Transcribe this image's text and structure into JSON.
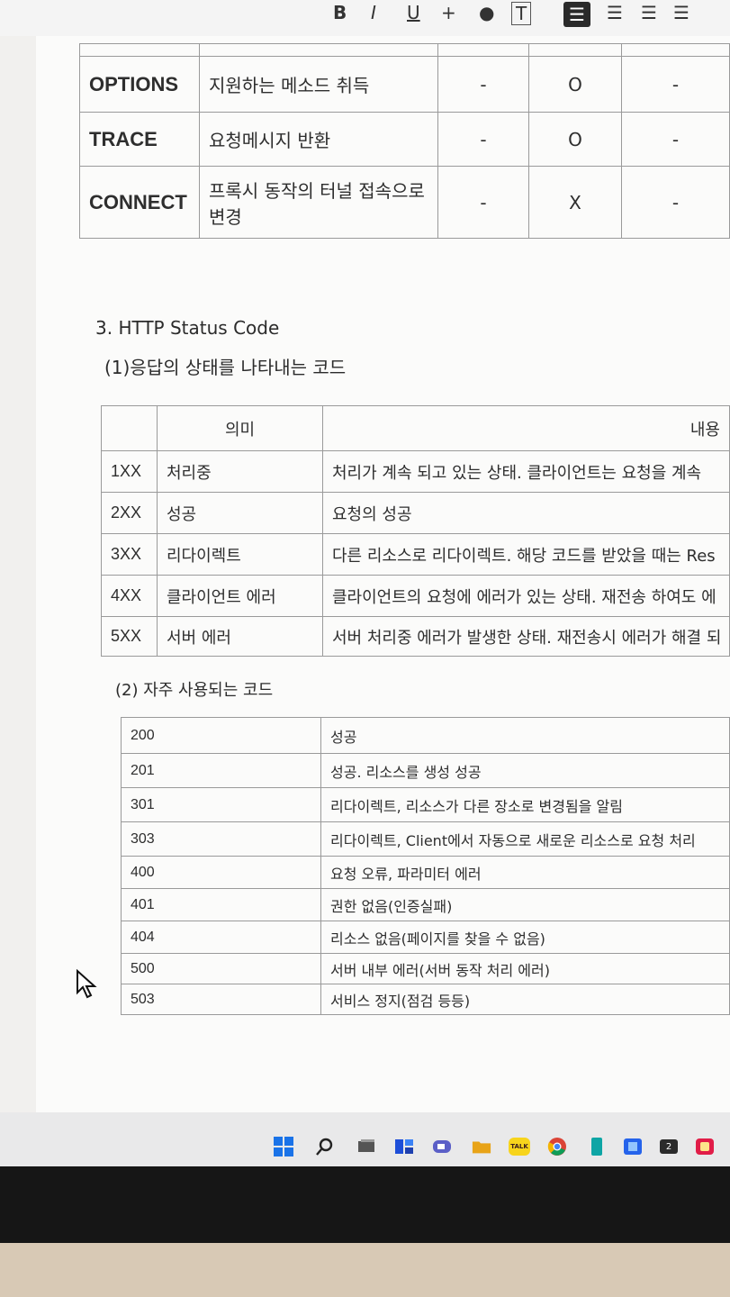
{
  "toolbar": {
    "buttons": [
      {
        "label": "B",
        "name": "bold"
      },
      {
        "label": "I",
        "name": "italic"
      },
      {
        "label": "U",
        "name": "underline"
      },
      {
        "label": "+",
        "name": "strikethrough"
      },
      {
        "label": "T",
        "name": "text-box"
      }
    ]
  },
  "methods_table": {
    "rows": [
      {
        "method": "OPTIONS",
        "desc": "지원하는 메소드 취득",
        "c1": "-",
        "c2": "O",
        "c3": "-"
      },
      {
        "method": "TRACE",
        "desc": "요청메시지 반환",
        "c1": "-",
        "c2": "O",
        "c3": "-"
      },
      {
        "method": "CONNECT",
        "desc": "프록시 동작의 터널 접속으로 변경",
        "c1": "-",
        "c2": "X",
        "c3": "-"
      }
    ]
  },
  "section": {
    "heading": "3. HTTP Status Code",
    "sub1": "(1)응답의 상태를 나타내는 코드",
    "sub2": "(2) 자주 사용되는 코드"
  },
  "status_table": {
    "header_meaning": "의미",
    "header_content": "내용",
    "rows": [
      {
        "code": "1XX",
        "meaning": "처리중",
        "content": "처리가 계속 되고 있는 상태. 클라이언트는 요청을 계속"
      },
      {
        "code": "2XX",
        "meaning": "성공",
        "content": "요청의 성공"
      },
      {
        "code": "3XX",
        "meaning": "리다이렉트",
        "content": "다른 리소스로 리다이렉트. 해당 코드를 받았을 때는 Res"
      },
      {
        "code": "4XX",
        "meaning": "클라이언트 에러",
        "content": "클라이언트의 요청에 에러가 있는 상태. 재전송 하여도 에"
      },
      {
        "code": "5XX",
        "meaning": "서버 에러",
        "content": "서버 처리중 에러가 발생한 상태. 재전송시 에러가 해결 되"
      }
    ]
  },
  "frequent_table": {
    "rows": [
      {
        "code": "200",
        "desc": "성공"
      },
      {
        "code": "201",
        "desc": "성공. 리소스를 생성 성공"
      },
      {
        "code": "301",
        "desc": "리다이렉트, 리소스가 다른 장소로 변경됨을 알림"
      },
      {
        "code": "303",
        "desc": "리다이렉트, Client에서 자동으로 새로운 리소스로 요청 처리"
      },
      {
        "code": "400",
        "desc": "요청 오류, 파라미터 에러"
      },
      {
        "code": "401",
        "desc": "권한 없음(인증실패)"
      },
      {
        "code": "404",
        "desc": "리소스 없음(페이지를 찾을 수 없음)"
      },
      {
        "code": "500",
        "desc": "서버 내부 에러(서버 동작 처리 에러)"
      },
      {
        "code": "503",
        "desc": "서비스 정지(점검 등등)"
      }
    ]
  },
  "taskbar": {
    "badge": "2",
    "chat_label": "TALK",
    "colors": {
      "windows": "#1a73e8",
      "folder": "#e8a317",
      "chat": "#f7d41c",
      "chrome": "#db4437"
    }
  }
}
